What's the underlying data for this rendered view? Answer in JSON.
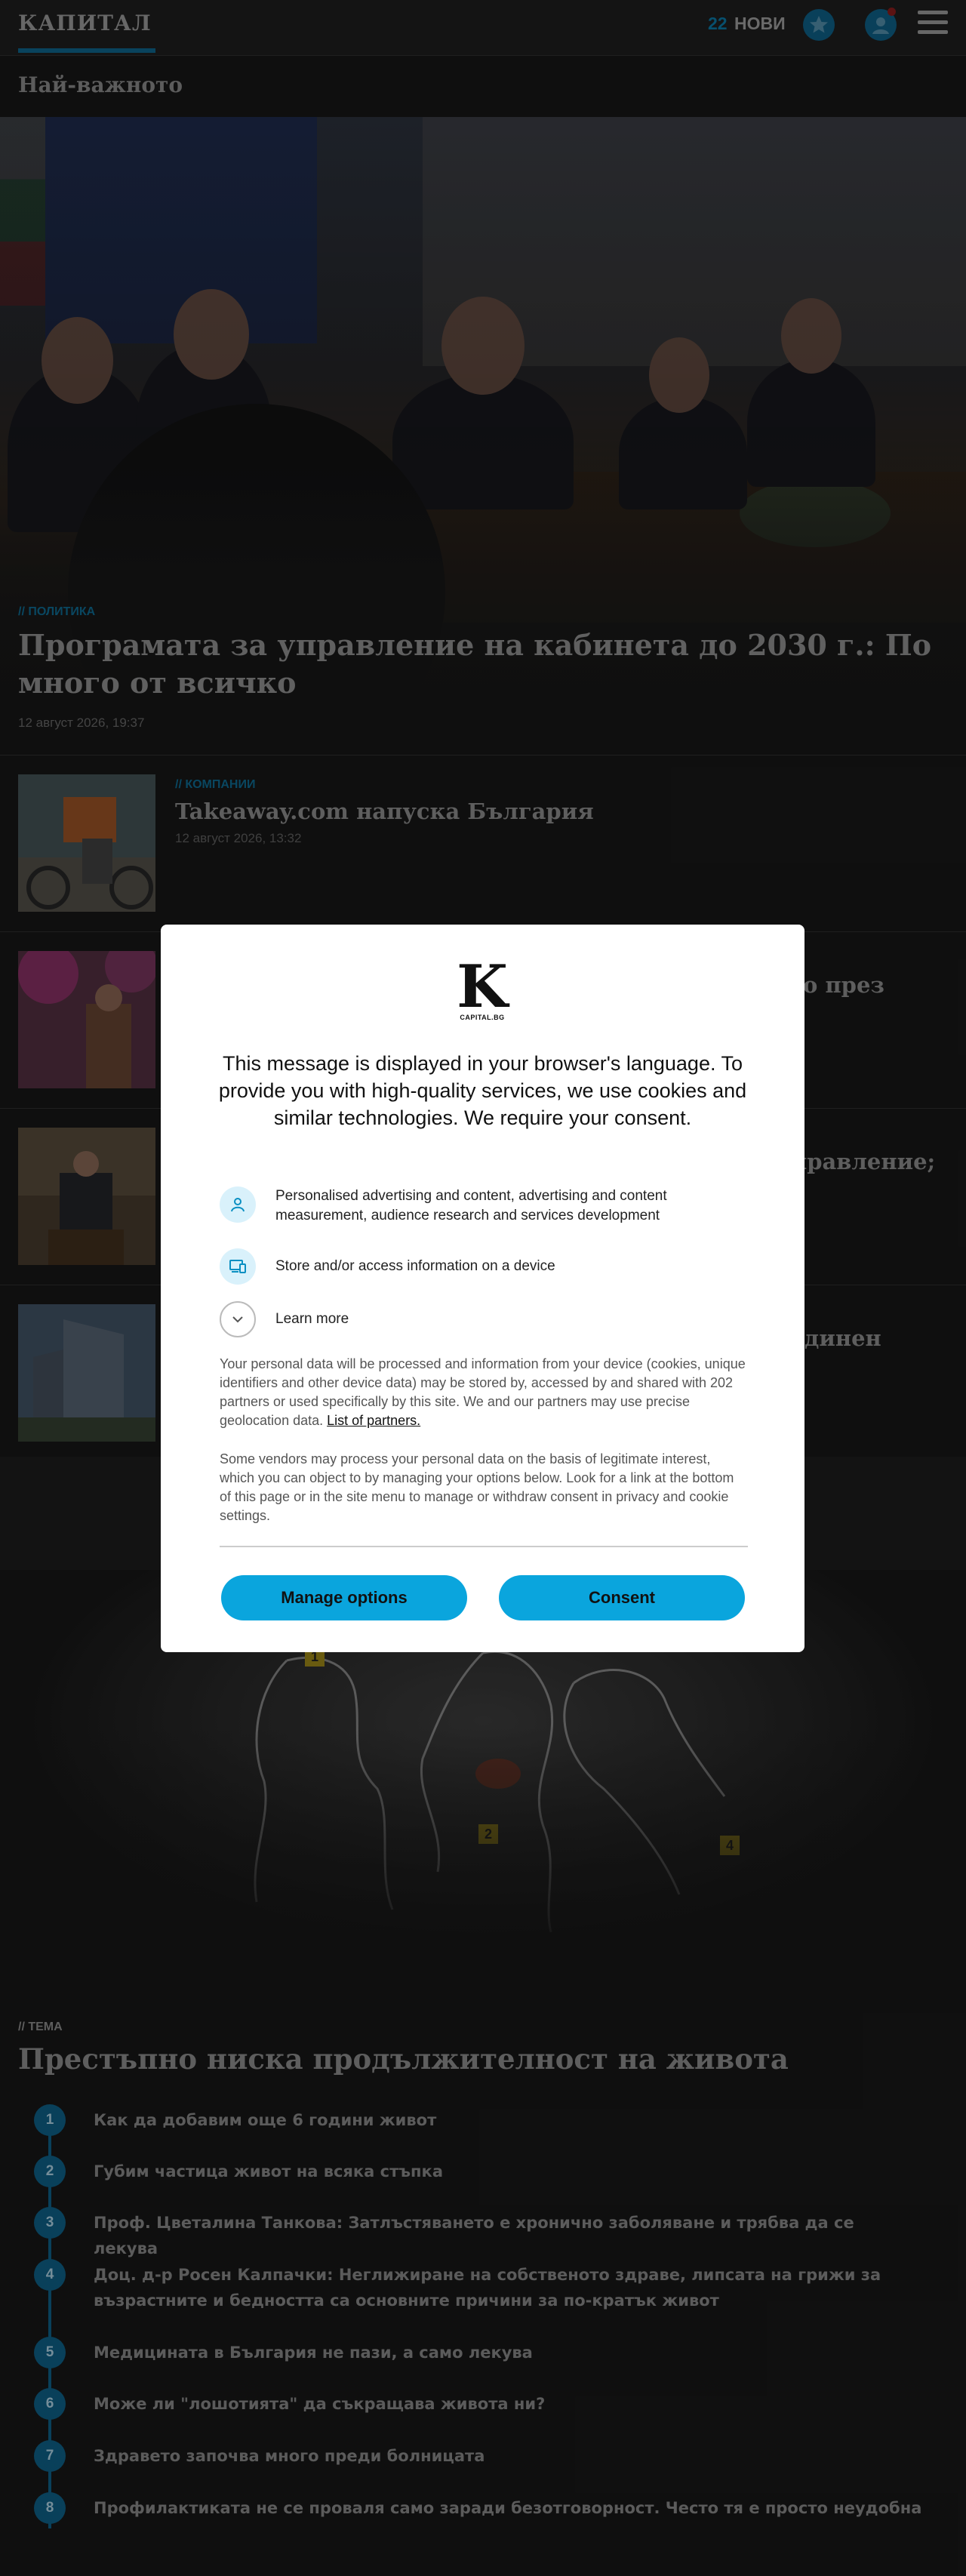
{
  "header": {
    "logo": "КАПИТАЛ",
    "new_count": "22",
    "new_label": "НОВИ"
  },
  "section_title": "Най-важното",
  "hero": {
    "tag": "// ПОЛИТИКА",
    "title": "Програмата за управление на кабинета до 2030 г.: По много от всичко",
    "date": "12 август 2026, 19:37"
  },
  "articles": [
    {
      "tag": "// КОМПАНИИ",
      "title": "Takeaway.com напуска България",
      "date": "12 август 2026, 13:32"
    },
    {
      "title_tail": "о през"
    },
    {
      "title_tail": "правление;"
    },
    {
      "title_tail": "динен"
    }
  ],
  "theme": {
    "tag": "// ТЕМА",
    "title": "Престъпно ниска продължителност на живота",
    "items": [
      {
        "num": "1",
        "text": "Как да добавим още 6 години живот"
      },
      {
        "num": "2",
        "text": "Губим частица живот на всяка стъпка"
      },
      {
        "num": "3",
        "text": "Проф. Цветалина Танкова: Затлъстяването е хронично заболяване и трябва да се лекува"
      },
      {
        "num": "4",
        "text": "Доц. д-р Росен Калпачки: Неглижиране на собственото здраве, липсата на грижи за възрастните и бедността са основните причини за по-кратък живот"
      },
      {
        "num": "5",
        "text": "Медицината в България не пази, а само лекува"
      },
      {
        "num": "6",
        "text": "Може ли \"лошотията\" да съкращава живота ни?"
      },
      {
        "num": "7",
        "text": "Здравето започва много преди болницата"
      },
      {
        "num": "8",
        "text": "Профилактиката не се проваля само заради безотговорност. Често тя е просто неудобна"
      }
    ]
  },
  "crime_markers": [
    "1",
    "2",
    "4"
  ],
  "consent": {
    "logo_letter": "K",
    "logo_sub": "CAPITAL.BG",
    "title": "This message is displayed in your browser's language. To provide you with high-quality services, we use cookies and similar technologies. We require your consent.",
    "purposes": [
      {
        "icon": "person-icon",
        "text": "Personalised advertising and content, advertising and content measurement, audience research and services development"
      },
      {
        "icon": "devices-icon",
        "text": "Store and/or access information on a device"
      },
      {
        "icon": "chevron-down-icon",
        "text": "Learn more"
      }
    ],
    "paragraph1": "Your personal data will be processed and information from your device (cookies, unique identifiers and other device data) may be stored by, accessed by and shared with 202 partners or used specifically by this site. We and our partners may use precise geolocation data.",
    "partners_link": "List of partners.",
    "paragraph2": "Some vendors may process your personal data on the basis of legitimate interest, which you can object to by managing your options below. Look for a link at the bottom of this page or in the site menu to manage or withdraw consent in privacy and cookie settings.",
    "manage_label": "Manage options",
    "consent_label": "Consent",
    "accent": "#0aa5dd"
  }
}
